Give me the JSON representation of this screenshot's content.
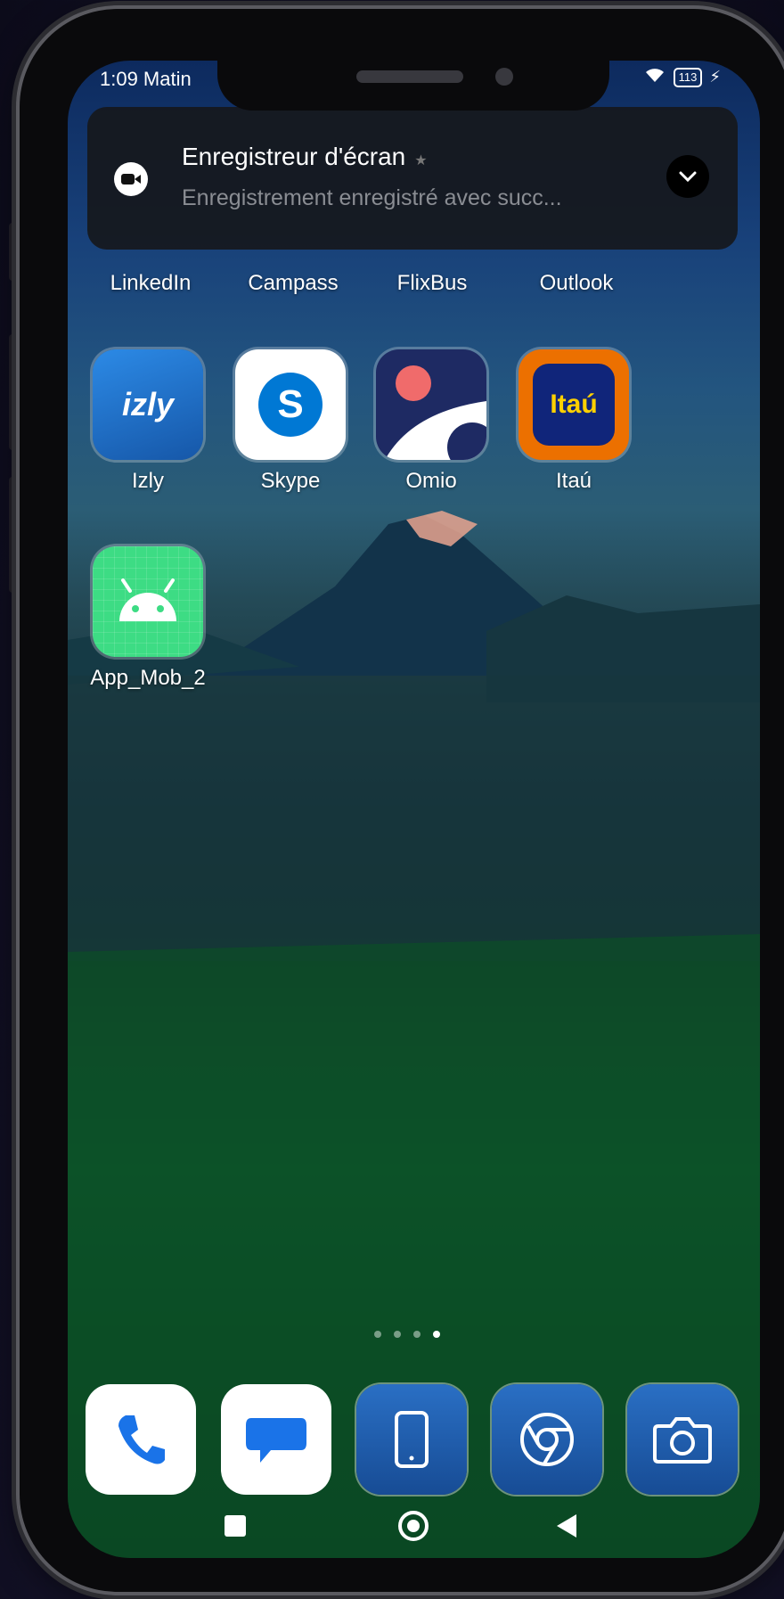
{
  "status_bar": {
    "time": "1:09 Matin",
    "battery": "113"
  },
  "notification": {
    "title": "Enregistreur d'écran",
    "body": "Enregistrement enregistré avec succ..."
  },
  "home_row_1": [
    {
      "label": "LinkedIn"
    },
    {
      "label": "Campass"
    },
    {
      "label": "FlixBus"
    },
    {
      "label": "Outlook"
    }
  ],
  "home_row_2": [
    {
      "label": "Izly",
      "icon_text": "izly",
      "color": "#1d7ad6"
    },
    {
      "label": "Skype",
      "icon_text": "S",
      "color": "#ffffff"
    },
    {
      "label": "Omio",
      "color": "#1e2a63"
    },
    {
      "label": "Itaú",
      "icon_text": "Itaú",
      "color": "#ec7000"
    }
  ],
  "home_row_3": [
    {
      "label": "App_Mob_2",
      "color": "#3ddc84"
    }
  ],
  "page_indicator": {
    "count": 4,
    "active": 4
  },
  "dock": [
    {
      "name": "phone-icon",
      "color": "#ffffff"
    },
    {
      "name": "messages-icon",
      "color": "#ffffff"
    },
    {
      "name": "device-icon",
      "color": "#1d5fae"
    },
    {
      "name": "chrome-icon",
      "color": "#1d5fae"
    },
    {
      "name": "camera-icon",
      "color": "#1d5fae"
    }
  ],
  "navigation": [
    "recents-icon",
    "home-icon",
    "back-icon"
  ],
  "colors": {
    "notification_bg": "#16181c",
    "accent_blue": "#1d5fae",
    "android_green": "#3ddc84"
  }
}
